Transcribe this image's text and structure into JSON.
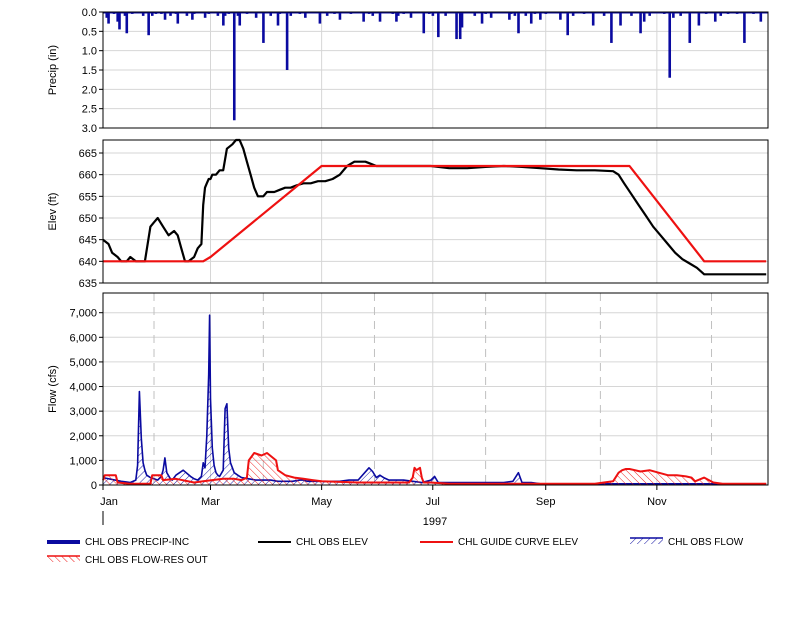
{
  "chart_data": [
    {
      "type": "bar",
      "ylabel": "Precip (in)",
      "ylim": [
        0.0,
        3.0
      ],
      "y_inverted": true,
      "yticks": [
        "0.0",
        "0.5",
        "1.0",
        "1.5",
        "2.0",
        "2.5",
        "3.0"
      ],
      "color": "#0a0aa0",
      "series": [
        {
          "name": "CHL OBS PRECIP-INC",
          "x": [
            2,
            3,
            6,
            8,
            9,
            12,
            13,
            16,
            22,
            25,
            27,
            29,
            32,
            34,
            37,
            40,
            41,
            46,
            49,
            50,
            56,
            58,
            63,
            66,
            67,
            69,
            72,
            74,
            75,
            79,
            84,
            88,
            92,
            96,
            97,
            101,
            103,
            108,
            111,
            119,
            123,
            127,
            130,
            136,
            143,
            146,
            148,
            152,
            159,
            161,
            162,
            165,
            169,
            176,
            179,
            181,
            184,
            188,
            194,
            196,
            197,
            204,
            208,
            210,
            213,
            223,
            224,
            226,
            228,
            232,
            235,
            237,
            240,
            243,
            251,
            255,
            258,
            264,
            269,
            275,
            279,
            284,
            290,
            295,
            297,
            300,
            308,
            311,
            313,
            317,
            322,
            327,
            331,
            336,
            339,
            343,
            348,
            352,
            357,
            361
          ],
          "values": [
            0.15,
            0.3,
            0.05,
            0.25,
            0.45,
            0.1,
            0.55,
            0.05,
            0.1,
            0.6,
            0.1,
            0.05,
            0.05,
            0.2,
            0.1,
            0.05,
            0.3,
            0.1,
            0.2,
            0.05,
            0.15,
            0.05,
            0.1,
            0.35,
            0.1,
            0.05,
            2.8,
            0.1,
            0.35,
            0.05,
            0.15,
            0.8,
            0.1,
            0.35,
            0.05,
            1.5,
            0.1,
            0.05,
            0.15,
            0.3,
            0.1,
            0.05,
            0.2,
            0.05,
            0.25,
            0.05,
            0.1,
            0.25,
            0.05,
            0.25,
            0.1,
            0.05,
            0.15,
            0.55,
            0.05,
            0.1,
            0.65,
            0.1,
            0.7,
            0.7,
            0.4,
            0.1,
            0.3,
            0.05,
            0.15,
            0.2,
            0.05,
            0.1,
            0.55,
            0.1,
            0.3,
            0.05,
            0.2,
            0.05,
            0.2,
            0.6,
            0.1,
            0.05,
            0.35,
            0.1,
            0.8,
            0.35,
            0.1,
            0.55,
            0.25,
            0.1,
            0.05,
            1.7,
            0.15,
            0.1,
            0.8,
            0.35,
            0.05,
            0.25,
            0.1,
            0.05,
            0.05,
            0.8,
            0.05,
            0.25
          ]
        }
      ]
    },
    {
      "type": "line",
      "ylabel": "Elev (ft)",
      "ylim": [
        635,
        668
      ],
      "yticks": [
        "635",
        "640",
        "645",
        "650",
        "655",
        "660",
        "665"
      ],
      "series": [
        {
          "name": "CHL OBS ELEV",
          "color": "#000000",
          "x": [
            0,
            3,
            5,
            8,
            10,
            13,
            15,
            18,
            20,
            23,
            26,
            28,
            30,
            33,
            36,
            39,
            41,
            43,
            45,
            47,
            50,
            52,
            54,
            55,
            56,
            57,
            58,
            59,
            60,
            62,
            64,
            66,
            68,
            71,
            73,
            75,
            77,
            79,
            81,
            83,
            85,
            88,
            90,
            92,
            94,
            97,
            100,
            103,
            106,
            110,
            114,
            118,
            122,
            126,
            130,
            134,
            138,
            141,
            144,
            147,
            150,
            153,
            156,
            159,
            162,
            165,
            170,
            180,
            190,
            200,
            210,
            220,
            230,
            240,
            250,
            260,
            270,
            280,
            283,
            286,
            290,
            294,
            298,
            302,
            306,
            310,
            314,
            318,
            322,
            326,
            330,
            334,
            338,
            342,
            346,
            350,
            355,
            359,
            364
          ],
          "y": [
            645,
            644,
            642,
            641,
            640,
            640,
            641,
            640,
            640,
            640,
            648,
            649,
            650,
            648,
            646,
            647,
            646,
            643,
            640,
            640,
            641,
            643,
            644,
            653,
            657,
            658,
            659,
            659,
            660,
            660,
            661,
            661,
            666,
            667,
            668,
            668,
            666,
            663,
            660,
            657,
            655,
            655,
            656,
            656,
            656,
            656.5,
            657,
            657,
            657.5,
            658,
            658,
            658.5,
            658.5,
            659,
            660,
            662,
            663,
            663,
            663,
            662.5,
            662,
            662,
            662,
            662,
            662,
            662,
            662,
            662,
            661.5,
            661.5,
            661.8,
            662,
            661.8,
            661.5,
            661.2,
            661,
            661,
            660.8,
            660,
            658,
            655.5,
            653,
            650.5,
            648,
            646,
            644,
            642,
            640.5,
            639.5,
            638.5,
            637,
            637,
            637,
            637,
            637,
            637,
            637,
            637,
            637
          ]
        },
        {
          "name": "CHL GUIDE CURVE ELEV",
          "color": "#ee1111",
          "x": [
            0,
            55,
            59,
            120,
            289,
            330,
            364
          ],
          "y": [
            640,
            640,
            641,
            662,
            662,
            640,
            640
          ]
        }
      ]
    },
    {
      "type": "line",
      "ylabel": "Flow (cfs)",
      "xlabel": "1997",
      "ylim": [
        0,
        7800
      ],
      "yticks": [
        "0",
        "1,000",
        "2,000",
        "3,000",
        "4,000",
        "5,000",
        "6,000",
        "7,000"
      ],
      "xticks": [
        "Jan",
        "Mar",
        "May",
        "Jul",
        "Sep",
        "Nov"
      ],
      "xtick_days": [
        0,
        59,
        120,
        181,
        243,
        304
      ],
      "minor_gridline_days": [
        28,
        88,
        149,
        210,
        273,
        334
      ],
      "series": [
        {
          "name": "CHL OBS FLOW",
          "color": "#0a0aa0",
          "x": [
            0,
            10,
            15,
            18,
            19,
            20,
            21,
            22,
            23,
            24,
            26,
            28,
            30,
            32,
            33,
            34,
            35,
            37,
            38,
            40,
            44,
            48,
            50,
            52,
            54,
            55,
            56,
            57,
            58,
            58.5,
            59,
            60,
            61,
            62,
            63,
            64,
            66,
            67,
            68,
            69,
            70,
            71,
            72,
            74,
            76,
            80,
            84,
            86,
            88,
            92,
            96,
            100,
            104,
            108,
            110,
            112,
            116,
            120,
            125,
            130,
            135,
            140,
            146,
            148,
            150,
            152,
            154,
            157,
            160,
            165,
            170,
            175,
            180,
            182,
            184,
            186,
            190,
            200,
            210,
            220,
            225,
            228,
            230,
            235,
            240,
            250,
            260,
            270,
            280,
            290,
            300,
            310,
            320,
            330,
            340,
            350,
            364
          ],
          "y": [
            300,
            150,
            100,
            200,
            800,
            3800,
            1900,
            900,
            600,
            400,
            300,
            250,
            200,
            350,
            600,
            1100,
            500,
            250,
            200,
            400,
            600,
            350,
            250,
            200,
            350,
            900,
            700,
            2000,
            4500,
            6900,
            3500,
            1500,
            800,
            500,
            400,
            350,
            600,
            3100,
            3300,
            1500,
            900,
            700,
            500,
            400,
            300,
            250,
            200,
            200,
            200,
            200,
            150,
            150,
            150,
            200,
            200,
            150,
            150,
            150,
            150,
            150,
            200,
            200,
            700,
            550,
            300,
            400,
            300,
            200,
            200,
            200,
            150,
            100,
            200,
            350,
            100,
            100,
            100,
            100,
            100,
            100,
            150,
            500,
            100,
            100,
            50,
            50,
            50,
            50,
            50,
            50,
            50,
            50,
            50,
            50,
            50,
            50,
            50
          ]
        },
        {
          "name": "CHL OBS FLOW-RES OUT",
          "color": "#ee1111",
          "x": [
            0,
            1,
            7,
            8,
            15,
            26,
            27,
            32,
            33,
            40,
            50,
            55,
            60,
            66,
            72,
            76,
            79,
            80,
            83,
            87,
            90,
            95,
            96,
            100,
            105,
            110,
            115,
            120,
            140,
            160,
            168,
            170,
            171,
            172,
            174,
            175,
            176,
            180,
            190,
            200,
            230,
            260,
            270,
            280,
            283,
            285,
            287,
            289,
            292,
            295,
            300,
            305,
            310,
            315,
            320,
            323,
            325,
            330,
            335,
            340,
            345,
            350,
            364
          ],
          "y": [
            200,
            400,
            400,
            100,
            50,
            50,
            400,
            400,
            200,
            250,
            100,
            150,
            200,
            250,
            250,
            200,
            300,
            1000,
            1300,
            1200,
            1300,
            1000,
            600,
            400,
            300,
            250,
            200,
            150,
            100,
            100,
            100,
            300,
            700,
            600,
            700,
            300,
            100,
            100,
            50,
            50,
            50,
            50,
            50,
            150,
            500,
            600,
            650,
            650,
            600,
            550,
            600,
            500,
            400,
            400,
            350,
            300,
            150,
            300,
            100,
            50,
            50,
            50,
            50
          ]
        }
      ]
    }
  ],
  "legend": [
    {
      "label": "CHL OBS PRECIP-INC",
      "style": "thick-bar",
      "color": "#0a0aa0"
    },
    {
      "label": "CHL OBS ELEV",
      "style": "line",
      "color": "#000000"
    },
    {
      "label": "CHL GUIDE CURVE ELEV",
      "style": "line",
      "color": "#ee1111"
    },
    {
      "label": "CHL OBS FLOW",
      "style": "hatch",
      "color": "#0a0aa0"
    },
    {
      "label": "CHL OBS FLOW-RES OUT",
      "style": "hatch",
      "color": "#ee1111"
    }
  ]
}
